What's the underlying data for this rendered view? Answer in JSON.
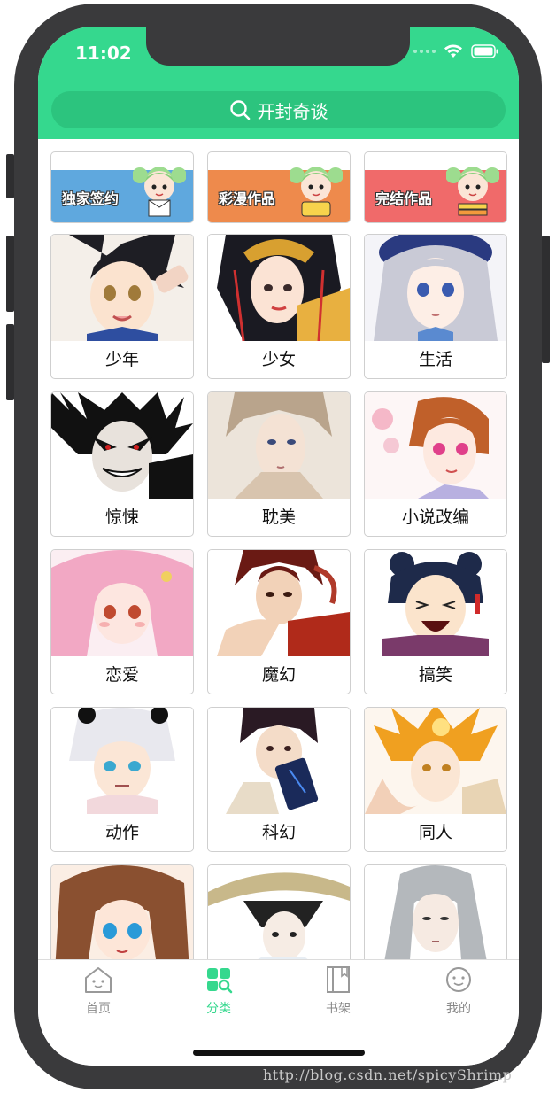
{
  "status_bar": {
    "time": "11:02"
  },
  "search": {
    "title": "开封奇谈"
  },
  "banners": [
    {
      "label": "独家签约",
      "color": "#5fa8de"
    },
    {
      "label": "彩漫作品",
      "color": "#ee8a4c"
    },
    {
      "label": "完结作品",
      "color": "#f06a6a"
    }
  ],
  "categories": [
    {
      "label": "少年"
    },
    {
      "label": "少女"
    },
    {
      "label": "生活"
    },
    {
      "label": "惊悚"
    },
    {
      "label": "耽美"
    },
    {
      "label": "小说改编"
    },
    {
      "label": "恋爱"
    },
    {
      "label": "魔幻"
    },
    {
      "label": "搞笑"
    },
    {
      "label": "动作"
    },
    {
      "label": "科幻"
    },
    {
      "label": "同人"
    },
    {
      "label": ""
    },
    {
      "label": ""
    },
    {
      "label": ""
    }
  ],
  "tabs": [
    {
      "label": "首页",
      "icon": "home-icon"
    },
    {
      "label": "分类",
      "icon": "category-icon",
      "active": true
    },
    {
      "label": "书架",
      "icon": "bookshelf-icon"
    },
    {
      "label": "我的",
      "icon": "profile-icon"
    }
  ],
  "colors": {
    "accent": "#35d88e",
    "search_bg": "#2cc47e"
  },
  "watermark": "http://blog.csdn.net/spicyShrimp"
}
